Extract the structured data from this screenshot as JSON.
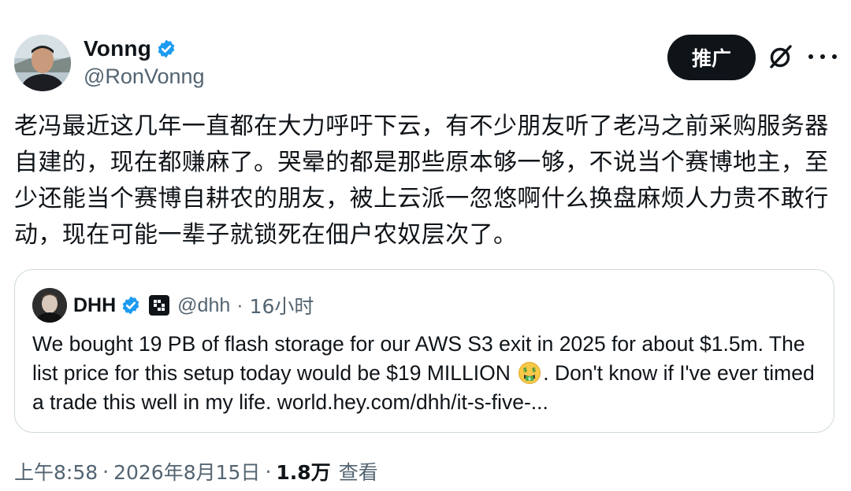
{
  "author": {
    "display_name": "Vonng",
    "handle": "@RonVonng",
    "verified_icon": "verified-badge-icon"
  },
  "actions": {
    "promote_label": "推广",
    "grok_icon": "grok-icon",
    "more_icon": "more-options-icon"
  },
  "tweet": {
    "text": "老冯最近这几年一直都在大力呼吁下云，有不少朋友听了老冯之前采购服务器自建的，现在都赚麻了。哭晕的都是那些原本够一够，不说当个赛博地主，至少还能当个赛博自耕农的朋友，被上云派一忽悠啊什么换盘麻烦人力贵不敢行动，现在可能一辈子就锁死在佃户农奴层次了。"
  },
  "quote": {
    "display_name": "DHH",
    "handle": "@dhh",
    "separator": "·",
    "time": "16小时",
    "text_before_emoji": "We bought 19 PB of flash storage for our AWS S3 exit in 2025 for about $1.5m. The list price for this setup today would be $19 MILLION ",
    "emoji": "money-mouth-face-icon",
    "text_after_emoji": ". Don't know if I've ever timed a trade this well in my life. world.hey.com/dhh/it-s-five-..."
  },
  "footer": {
    "time": "上午8:58",
    "separator": "·",
    "date": "2026年8月15日",
    "views_count": "1.8万",
    "views_label": "查看"
  },
  "colors": {
    "text": "#0f1419",
    "secondary": "#536471",
    "verified": "#1d9bf0",
    "border": "#cfd9de"
  }
}
